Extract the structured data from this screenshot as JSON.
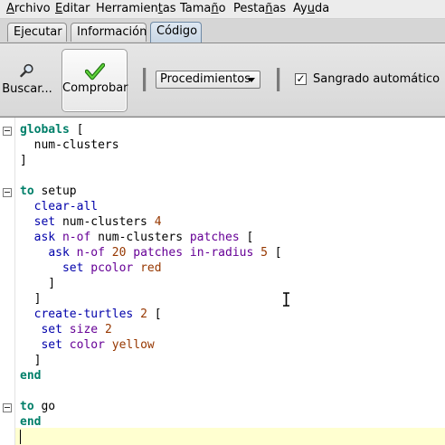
{
  "menubar": {
    "items": [
      {
        "pre": "",
        "mn": "A",
        "post": "rchivo"
      },
      {
        "pre": "",
        "mn": "E",
        "post": "ditar"
      },
      {
        "pre": "Herramien",
        "mn": "t",
        "post": "as"
      },
      {
        "pre": "Tama",
        "mn": "ñ",
        "post": "o"
      },
      {
        "pre": "Pesta",
        "mn": "ñ",
        "post": "as"
      },
      {
        "pre": "Ay",
        "mn": "u",
        "post": "da"
      }
    ]
  },
  "tabs": {
    "items": [
      "Ejecutar",
      "Información",
      "Código"
    ],
    "active": "Código"
  },
  "toolbar": {
    "find_label": "Buscar...",
    "check_label": "Comprobar",
    "procedures_label": "Procedimientos",
    "autoindent_checked": true,
    "autoindent_label": "Sangrado automático"
  },
  "colors": {
    "keyword": "#007f69",
    "command": "#0000aa",
    "reporter": "#660096",
    "constant": "#963700",
    "current_line": "#ffffd0"
  },
  "code": {
    "lines": [
      [
        {
          "t": "globals",
          "c": "kw"
        },
        {
          "t": " [",
          "c": "var"
        }
      ],
      [
        {
          "t": "  num-clusters",
          "c": "var"
        }
      ],
      [
        {
          "t": "]",
          "c": "var"
        }
      ],
      [],
      [
        {
          "t": "to",
          "c": "kw"
        },
        {
          "t": " setup",
          "c": "var"
        }
      ],
      [
        {
          "t": "  ",
          "c": "var"
        },
        {
          "t": "clear-all",
          "c": "cmd"
        }
      ],
      [
        {
          "t": "  ",
          "c": "var"
        },
        {
          "t": "set",
          "c": "cmd"
        },
        {
          "t": " num-clusters ",
          "c": "var"
        },
        {
          "t": "4",
          "c": "num"
        }
      ],
      [
        {
          "t": "  ",
          "c": "var"
        },
        {
          "t": "ask",
          "c": "cmd"
        },
        {
          "t": " ",
          "c": "var"
        },
        {
          "t": "n-of",
          "c": "rep"
        },
        {
          "t": " num-clusters ",
          "c": "var"
        },
        {
          "t": "patches",
          "c": "rep"
        },
        {
          "t": " [",
          "c": "var"
        }
      ],
      [
        {
          "t": "    ",
          "c": "var"
        },
        {
          "t": "ask",
          "c": "cmd"
        },
        {
          "t": " ",
          "c": "var"
        },
        {
          "t": "n-of",
          "c": "rep"
        },
        {
          "t": " ",
          "c": "var"
        },
        {
          "t": "20",
          "c": "num"
        },
        {
          "t": " ",
          "c": "var"
        },
        {
          "t": "patches",
          "c": "rep"
        },
        {
          "t": " ",
          "c": "var"
        },
        {
          "t": "in-radius",
          "c": "rep"
        },
        {
          "t": " ",
          "c": "var"
        },
        {
          "t": "5",
          "c": "num"
        },
        {
          "t": " [",
          "c": "var"
        }
      ],
      [
        {
          "t": "      ",
          "c": "var"
        },
        {
          "t": "set",
          "c": "cmd"
        },
        {
          "t": " ",
          "c": "var"
        },
        {
          "t": "pcolor",
          "c": "rep"
        },
        {
          "t": " ",
          "c": "var"
        },
        {
          "t": "red",
          "c": "con"
        }
      ],
      [
        {
          "t": "    ]",
          "c": "var"
        }
      ],
      [
        {
          "t": "  ]",
          "c": "var"
        }
      ],
      [
        {
          "t": "  ",
          "c": "var"
        },
        {
          "t": "create-turtles",
          "c": "cmd"
        },
        {
          "t": " ",
          "c": "var"
        },
        {
          "t": "2",
          "c": "num"
        },
        {
          "t": " [",
          "c": "var"
        }
      ],
      [
        {
          "t": "   ",
          "c": "var"
        },
        {
          "t": "set",
          "c": "cmd"
        },
        {
          "t": " ",
          "c": "var"
        },
        {
          "t": "size",
          "c": "rep"
        },
        {
          "t": " ",
          "c": "var"
        },
        {
          "t": "2",
          "c": "num"
        }
      ],
      [
        {
          "t": "   ",
          "c": "var"
        },
        {
          "t": "set",
          "c": "cmd"
        },
        {
          "t": " ",
          "c": "var"
        },
        {
          "t": "color",
          "c": "rep"
        },
        {
          "t": " ",
          "c": "var"
        },
        {
          "t": "yellow",
          "c": "con"
        }
      ],
      [
        {
          "t": "  ]",
          "c": "var"
        }
      ],
      [
        {
          "t": "end",
          "c": "kw"
        }
      ],
      [],
      [
        {
          "t": "to",
          "c": "kw"
        },
        {
          "t": " go",
          "c": "var"
        }
      ],
      [
        {
          "t": "end",
          "c": "kw"
        }
      ],
      []
    ]
  }
}
